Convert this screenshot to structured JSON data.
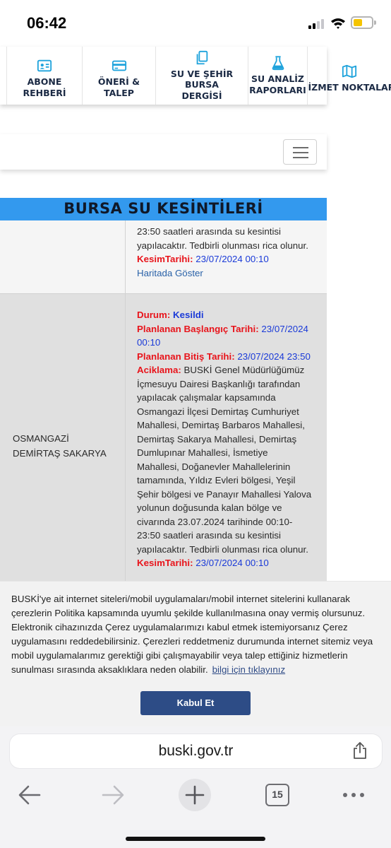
{
  "status": {
    "time": "06:42"
  },
  "nav": {
    "items": [
      {
        "label": "ABONE REHBERİ",
        "icon": "id-card-icon"
      },
      {
        "label": "ÖNERİ & TALEP",
        "icon": "credit-card-icon"
      },
      {
        "label_line1": "SU VE ŞEHİR BURSA",
        "label_line2": "DERGİSİ",
        "icon": "document-copy-icon"
      },
      {
        "label_line1": "SU ANALİZ",
        "label_line2": "RAPORLARI",
        "icon": "flask-icon"
      },
      {
        "label": "HİZMET NOKTALARI",
        "icon": "map-icon"
      }
    ],
    "accent_color": "#1fa3dc"
  },
  "page": {
    "title": "BURSA SU KESİNTİLERİ",
    "title_band_color": "#3399ee"
  },
  "table": {
    "row1": {
      "lines": [
        "23:50 saatleri arasında su kesintisi",
        "yapılacaktır. Tedbirli olunması rica olunur."
      ],
      "kesim_label": "KesimTarihi:",
      "kesim_value": "23/07/2024 00:10",
      "map_link": "Haritada Göster"
    },
    "row2": {
      "region_line1": "OSMANGAZİ",
      "region_line2": "DEMİRTAŞ SAKARYA",
      "durum_label": "Durum:",
      "durum_value": "Kesildi",
      "start_label": "Planlanan Başlangıç Tarihi:",
      "start_value_a": "23/07/2024",
      "start_value_b": "00:10",
      "end_label": "Planlanan Bitiş Tarihi:",
      "end_value": "23/07/2024 23:50",
      "desc_label": "Aciklama:",
      "desc_first": "BUSKİ Genel Müdürlüğümüz",
      "desc_lines": [
        "İçmesuyu Dairesi Başkanlığı tarafından",
        "yapılacak çalışmalar kapsamında",
        "Osmangazi İlçesi Demirtaş Cumhuriyet",
        "Mahallesi, Demirtaş Barbaros Mahallesi,",
        "Demirtaş Sakarya Mahallesi, Demirtaş",
        "Dumlupınar Mahallesi, İsmetiye",
        "Mahallesi, Doğanevler Mahallelerinin",
        "tamamında, Yıldız Evleri bölgesi, Yeşil",
        "Şehir bölgesi ve Panayır Mahallesi Yalova",
        "yolunun doğusunda kalan bölge ve",
        "civarında 23.07.2024 tarihinde 00:10-",
        "23:50 saatleri arasında su kesintisi",
        "yapılacaktır. Tedbirli olunması rica olunur."
      ],
      "kesim_label": "KesimTarihi:",
      "kesim_value": "23/07/2024 00:10"
    }
  },
  "cookie": {
    "lines": [
      "BUSKİ'ye ait internet siteleri/mobil uygulamaları/mobil internet sitelerini kullanarak",
      "çerezlerin Politika kapsamında uyumlu şekilde kullanılmasına onay vermiş olursunuz.",
      "Elektronik cihazınızda Çerez uygulamalarımızı kabul etmek istemiyorsanız Çerez",
      "uygulamasını reddedebilirsiniz. Çerezleri reddetmeniz durumunda internet sitemiz veya",
      "mobil uygulamalarımız gerektiği gibi çalışmayabilir veya talep ettiğiniz hizmetlerin"
    ],
    "last_line": "sunulması sırasında aksaklıklara neden olabilir.",
    "more_link": "bilgi için tıklayınız",
    "accept_label": "Kabul Et"
  },
  "browser": {
    "url": "buski.gov.tr",
    "tab_count": "15"
  }
}
